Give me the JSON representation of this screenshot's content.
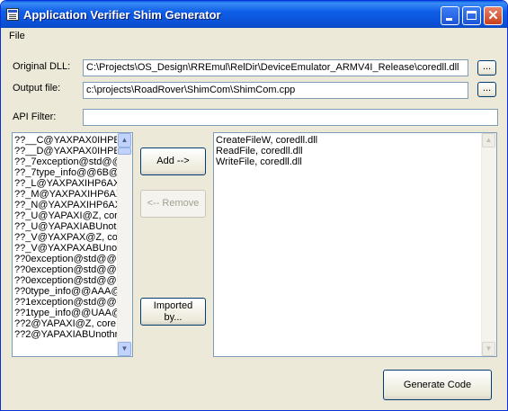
{
  "window": {
    "title": "Application Verifier Shim Generator"
  },
  "menu": {
    "file": "File"
  },
  "form": {
    "original_dll_label": "Original DLL:",
    "original_dll_value": "C:\\Projects\\OS_Design\\RREmul\\RelDir\\DeviceEmulator_ARMV4I_Release\\coredll.dll",
    "output_file_label": "Output file:",
    "output_file_value": "c:\\projects\\RoadRover\\ShimCom\\ShimCom.cpp",
    "api_filter_label": "API Filter:",
    "api_filter_value": "",
    "browse_label": "..."
  },
  "left_list": {
    "items": [
      "??__C@YAXPAX0IHPE",
      "??__D@YAXPAX0IHPE",
      "??_7exception@std@@",
      "??_7type_info@@6B@",
      "??_L@YAXPAXIHP6AX",
      "??_M@YAXPAXIHP6AX",
      "??_N@YAXPAXIHP6AX",
      "??_U@YAPAXI@Z, cor",
      "??_U@YAPAXIABUnot",
      "??_V@YAXPAX@Z, co",
      "??_V@YAXPAXABUno",
      "??0exception@std@@",
      "??0exception@std@@",
      "??0exception@std@@",
      "??0type_info@@AAA@",
      "??1exception@std@@",
      "??1type_info@@UAA@",
      "??2@YAPAXI@Z, core",
      "??2@YAPAXIABUnothr"
    ]
  },
  "buttons": {
    "add": "Add -->",
    "remove": "<-- Remove",
    "imported_by_line1": "Imported",
    "imported_by_line2": "by...",
    "generate": "Generate Code"
  },
  "right_list": {
    "items": [
      "CreateFileW, coredll.dll",
      "ReadFile, coredll.dll",
      "WriteFile, coredll.dll"
    ]
  }
}
